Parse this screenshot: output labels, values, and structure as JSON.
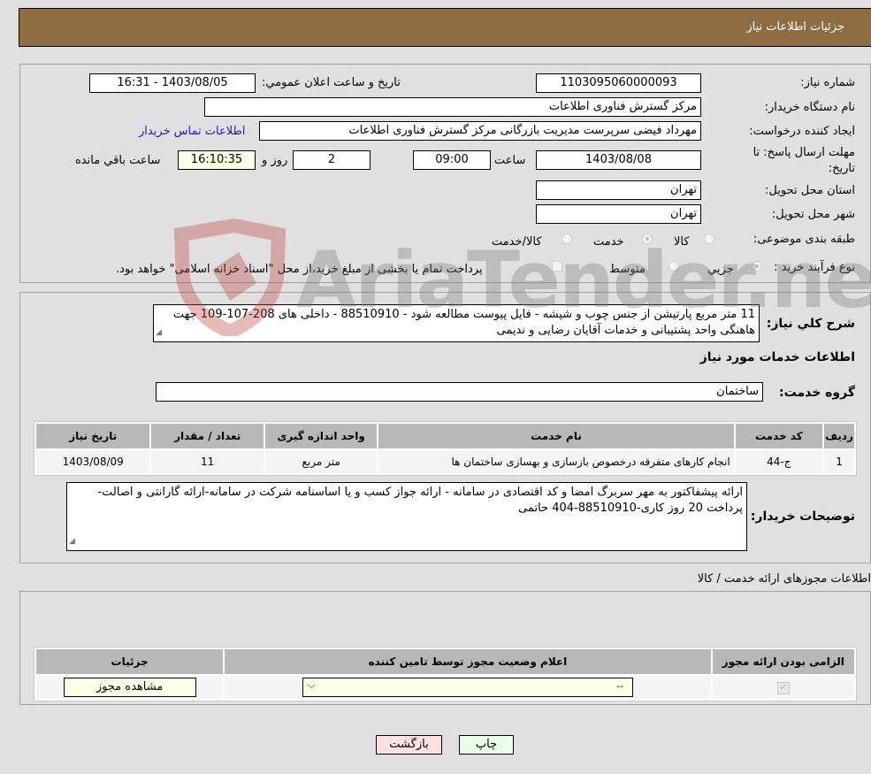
{
  "header": {
    "title": "جزئيات اطلاعات نياز"
  },
  "form": {
    "need_number_label": "شماره نیاز:",
    "need_number": "1103095060000093",
    "announce_label": "تاریخ و ساعت اعلان عمومي:",
    "announce_value": "1403/08/05 - 16:31",
    "buyer_org_label": "نام دستگاه خریدار:",
    "buyer_org": "مرکز گسترش فناوری اطلاعات",
    "requester_label": "ایجاد کننده درخواست:",
    "requester": "مهرداد فیضی سرپرست مدیریت بازرگانی مرکز گسترش فناوری اطلاعات",
    "contact_link": "اطلاعات تماس خریدار",
    "deadline_label_1": "مهلت ارسال پاسخ: تا",
    "deadline_label_2": "تاریخ:",
    "deadline_date": "1403/08/08",
    "time_label": "ساعت",
    "deadline_time": "09:00",
    "days_value": "2",
    "days_label": "روز و",
    "remaining_time": "16:10:35",
    "remaining_label": "ساعت باقي مانده",
    "province_label": "استان محل تحویل:",
    "province": "تهران",
    "city_label": "شهر محل تحویل:",
    "city": "تهران",
    "category_label": "طبقه بندی موضوعی:",
    "category_options": [
      {
        "label": "کالا",
        "checked": false
      },
      {
        "label": "خدمت",
        "checked": true
      },
      {
        "label": "کالا/خدمت",
        "checked": false
      }
    ],
    "process_label": "نوع فرآیند خرید :",
    "process_options": [
      {
        "label": "جزيي",
        "checked": true
      },
      {
        "label": "متوسط",
        "checked": false
      }
    ],
    "treasury_note": "پرداخت تمام یا بخشی از مبلغ خرید،از محل \"اسناد خزانه اسلامی\" خواهد بود."
  },
  "details": {
    "description_label": "شرح كلي نياز:",
    "description": "11 متر مربع پارتیشن از جنس چوب و شیشه - فایل پیوست مطالعه شود - 88510910 - داخلی های 208-107-109 جهت هاهنگی واحد پشتیبانی و خدمات آقایان رضایی و ندیمی",
    "services_heading": "اطلاعات خدمات مورد نياز",
    "service_group_label": "گروه خدمت:",
    "service_group": "ساختمان",
    "table": {
      "headers": [
        "ردیف",
        "کد خدمت",
        "نام خدمت",
        "واحد اندازه گیری",
        "تعداد / مقدار",
        "تاریخ نیاز"
      ],
      "rows": [
        [
          "1",
          "ج-44",
          "انجام کارهای متفرقه درخصوص بازسازی و بهسازی ساختمان ها",
          "متر مربع",
          "11",
          "1403/08/09"
        ]
      ]
    },
    "buyer_notes_label": "توضیحات خریدار:",
    "buyer_notes": "ارائه پیشفاکتور به مهر سربرگ امضا و کد اقتصادی در سامانه - ارائه جواز کسب و یا اساسنامه شرکت در سامانه-ارائه گارانتی و اصالت-پرداخت 20 روز کاری-88510910-404 حاتمی"
  },
  "permits": {
    "heading": "اطلاعات مجوزهای ارائه خدمت / کالا",
    "headers": [
      "الزامی بودن ارائه مجوز",
      "اعلام وضعیت مجوز توسط تامین کننده",
      "جزئیات"
    ],
    "row": {
      "required_checked": true,
      "status_value": "--",
      "details_button": "مشاهده مجوز"
    }
  },
  "buttons": {
    "print": "چاپ",
    "back": "بازگشت"
  },
  "watermark": {
    "text": "AriaTender.neT"
  },
  "colors": {
    "header_bg": "#8e6d42",
    "print_bg": "#eaffea",
    "back_bg": "#ffe0e0",
    "link": "#1a1acc"
  }
}
